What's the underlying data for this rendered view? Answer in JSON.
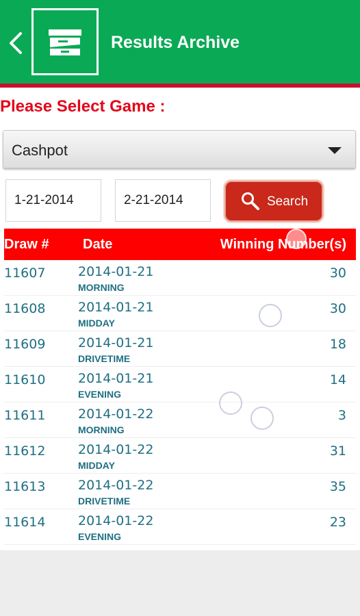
{
  "header": {
    "title": "Results Archive",
    "bg_color": "#0aa955",
    "back_icon": "chevron-left-icon",
    "logo_icon": "archive-drawer-icon"
  },
  "filters": {
    "select_label": "Please Select Game :",
    "game": {
      "selected": "Cashpot"
    },
    "date_from": "1-21-2014",
    "date_to": "2-21-2014",
    "search_label": "Search"
  },
  "table": {
    "headers": {
      "draw": "Draw #",
      "date": "Date",
      "numbers": "Winning Number(s)"
    },
    "header_color": "#fe0000",
    "rows": [
      {
        "draw": "11607",
        "date": "2014-01-21",
        "time": "MORNING",
        "number": "30"
      },
      {
        "draw": "11608",
        "date": "2014-01-21",
        "time": "MIDDAY",
        "number": "30"
      },
      {
        "draw": "11609",
        "date": "2014-01-21",
        "time": "DRIVETIME",
        "number": "18"
      },
      {
        "draw": "11610",
        "date": "2014-01-21",
        "time": "EVENING",
        "number": "14"
      },
      {
        "draw": "11611",
        "date": "2014-01-22",
        "time": "MORNING",
        "number": "3"
      },
      {
        "draw": "11612",
        "date": "2014-01-22",
        "time": "MIDDAY",
        "number": "31"
      },
      {
        "draw": "11613",
        "date": "2014-01-22",
        "time": "DRIVETIME",
        "number": "35"
      },
      {
        "draw": "11614",
        "date": "2014-01-22",
        "time": "EVENING",
        "number": "23"
      }
    ]
  }
}
